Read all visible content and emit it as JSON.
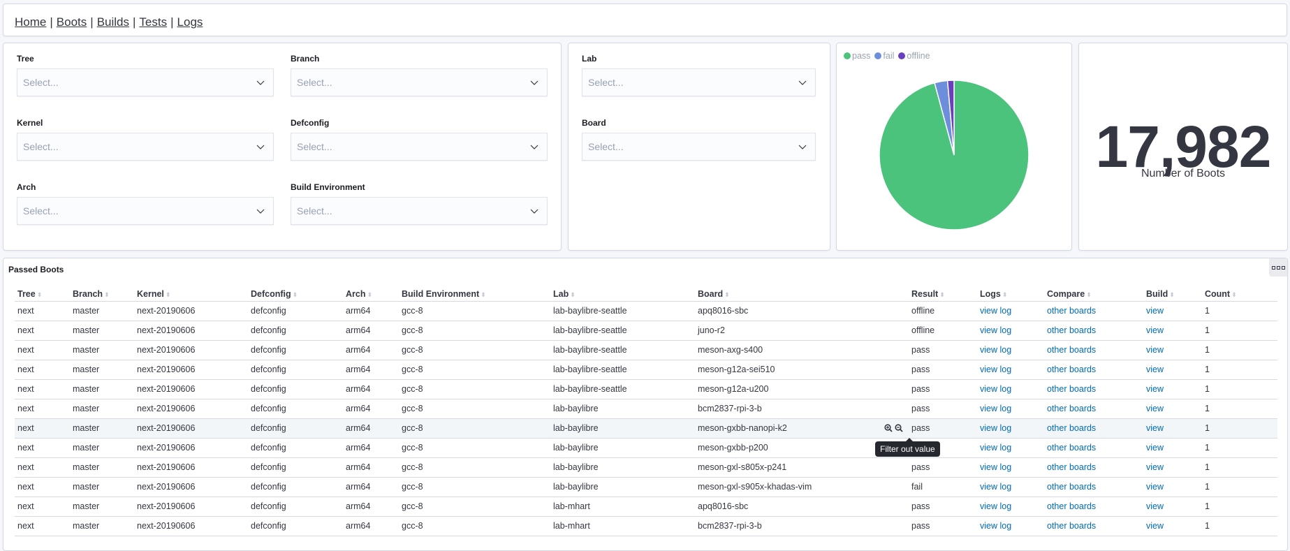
{
  "nav": {
    "links": [
      "Home",
      "Boots",
      "Builds",
      "Tests",
      "Logs"
    ],
    "separator": "|"
  },
  "filters": {
    "tree": {
      "label": "Tree",
      "placeholder": "Select..."
    },
    "branch": {
      "label": "Branch",
      "placeholder": "Select..."
    },
    "kernel": {
      "label": "Kernel",
      "placeholder": "Select..."
    },
    "defconfig": {
      "label": "Defconfig",
      "placeholder": "Select..."
    },
    "arch": {
      "label": "Arch",
      "placeholder": "Select..."
    },
    "build_environment": {
      "label": "Build Environment",
      "placeholder": "Select..."
    },
    "lab": {
      "label": "Lab",
      "placeholder": "Select..."
    },
    "board": {
      "label": "Board",
      "placeholder": "Select..."
    }
  },
  "chart_data": {
    "type": "pie",
    "title": "",
    "legend_position": "top-left",
    "categories": [
      "pass",
      "fail",
      "offline"
    ],
    "values": [
      95.8,
      2.8,
      1.4
    ],
    "unit": "percent (estimated)",
    "colors": [
      "#4bc37c",
      "#6d8edb",
      "#6a3fbd"
    ]
  },
  "metric": {
    "value": "17,982",
    "label": "Number of Boots"
  },
  "table": {
    "title": "Passed Boots",
    "tooltip": "Filter out value",
    "columns": [
      "Tree",
      "Branch",
      "Kernel",
      "Defconfig",
      "Arch",
      "Build Environment",
      "Lab",
      "Board",
      "Result",
      "Logs",
      "Compare",
      "Build",
      "Count"
    ],
    "rows": [
      [
        "next",
        "master",
        "next-20190606",
        "defconfig",
        "arm64",
        "gcc-8",
        "lab-baylibre-seattle",
        "apq8016-sbc",
        "offline",
        "view log",
        "other boards",
        "view",
        "1"
      ],
      [
        "next",
        "master",
        "next-20190606",
        "defconfig",
        "arm64",
        "gcc-8",
        "lab-baylibre-seattle",
        "juno-r2",
        "offline",
        "view log",
        "other boards",
        "view",
        "1"
      ],
      [
        "next",
        "master",
        "next-20190606",
        "defconfig",
        "arm64",
        "gcc-8",
        "lab-baylibre-seattle",
        "meson-axg-s400",
        "pass",
        "view log",
        "other boards",
        "view",
        "1"
      ],
      [
        "next",
        "master",
        "next-20190606",
        "defconfig",
        "arm64",
        "gcc-8",
        "lab-baylibre-seattle",
        "meson-g12a-sei510",
        "pass",
        "view log",
        "other boards",
        "view",
        "1"
      ],
      [
        "next",
        "master",
        "next-20190606",
        "defconfig",
        "arm64",
        "gcc-8",
        "lab-baylibre-seattle",
        "meson-g12a-u200",
        "pass",
        "view log",
        "other boards",
        "view",
        "1"
      ],
      [
        "next",
        "master",
        "next-20190606",
        "defconfig",
        "arm64",
        "gcc-8",
        "lab-baylibre",
        "bcm2837-rpi-3-b",
        "pass",
        "view log",
        "other boards",
        "view",
        "1"
      ],
      [
        "next",
        "master",
        "next-20190606",
        "defconfig",
        "arm64",
        "gcc-8",
        "lab-baylibre",
        "meson-gxbb-nanopi-k2",
        "pass",
        "view log",
        "other boards",
        "view",
        "1"
      ],
      [
        "next",
        "master",
        "next-20190606",
        "defconfig",
        "arm64",
        "gcc-8",
        "lab-baylibre",
        "meson-gxbb-p200",
        "pass",
        "view log",
        "other boards",
        "view",
        "1"
      ],
      [
        "next",
        "master",
        "next-20190606",
        "defconfig",
        "arm64",
        "gcc-8",
        "lab-baylibre",
        "meson-gxl-s805x-p241",
        "pass",
        "view log",
        "other boards",
        "view",
        "1"
      ],
      [
        "next",
        "master",
        "next-20190606",
        "defconfig",
        "arm64",
        "gcc-8",
        "lab-baylibre",
        "meson-gxl-s905x-khadas-vim",
        "fail",
        "view log",
        "other boards",
        "view",
        "1"
      ],
      [
        "next",
        "master",
        "next-20190606",
        "defconfig",
        "arm64",
        "gcc-8",
        "lab-mhart",
        "apq8016-sbc",
        "pass",
        "view log",
        "other boards",
        "view",
        "1"
      ],
      [
        "next",
        "master",
        "next-20190606",
        "defconfig",
        "arm64",
        "gcc-8",
        "lab-mhart",
        "bcm2837-rpi-3-b",
        "pass",
        "view log",
        "other boards",
        "view",
        "1"
      ]
    ],
    "hovered_row": 6,
    "link_color": "#006bb4"
  }
}
